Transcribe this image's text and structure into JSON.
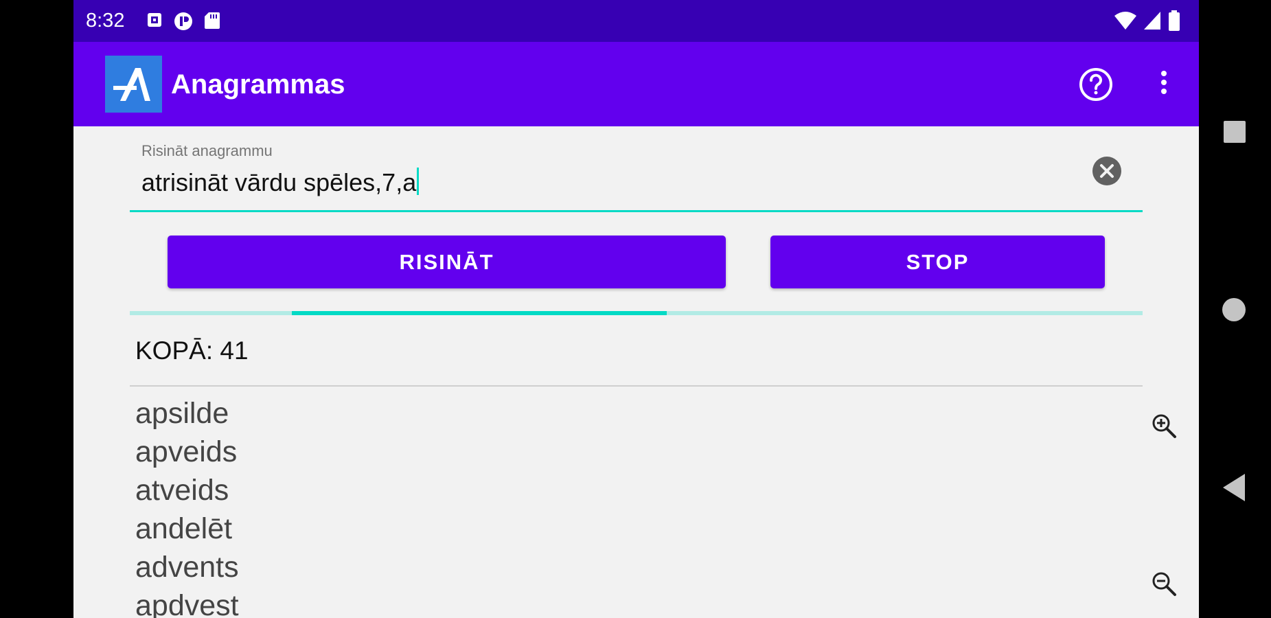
{
  "status_bar": {
    "time": "8:32",
    "left_icons": [
      "screenshot-icon",
      "app-notification-icon",
      "sd-card-icon"
    ],
    "right_icons": [
      "wifi-icon",
      "signal-icon",
      "battery-icon"
    ]
  },
  "app_bar": {
    "title": "Anagrammas",
    "logo_icon": "anagram-logo-icon",
    "actions": [
      "help-icon",
      "overflow-menu-icon"
    ]
  },
  "input": {
    "label": "Risināt anagrammu",
    "value": "atrisināt vārdu spēles,7,a"
  },
  "buttons": {
    "solve": "RISINĀT",
    "stop": "STOP"
  },
  "progress": {
    "indeterminate": true,
    "segment_start": 0.16,
    "segment_end": 0.53
  },
  "results": {
    "total_label": "KOPĀ: 41",
    "items": [
      "apsilde",
      "apveids",
      "atveids",
      "andelēt",
      "advents",
      "apdvest"
    ]
  },
  "colors": {
    "status_bar": "#3700b3",
    "primary": "#6200ee",
    "accent": "#03dac5",
    "background": "#f2f2f2"
  }
}
